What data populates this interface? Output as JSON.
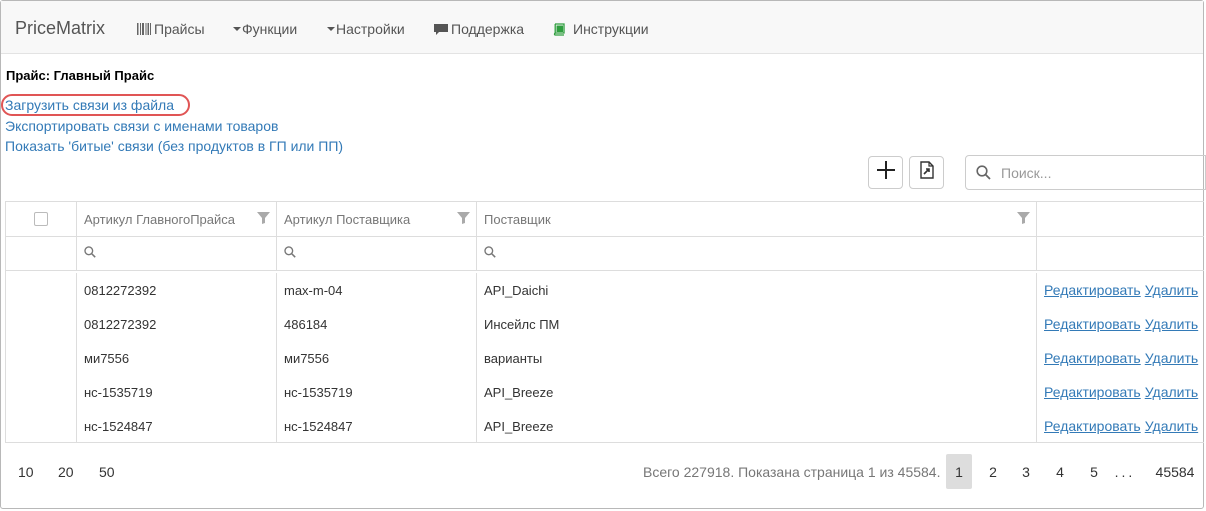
{
  "navbar": {
    "brand": "PriceMatrix",
    "items": [
      {
        "label": "Прайсы",
        "icon": "barcode-icon"
      },
      {
        "label": "Функции",
        "icon": "caret-down-icon"
      },
      {
        "label": "Настройки",
        "icon": "caret-down-icon"
      },
      {
        "label": "Поддержка",
        "icon": "comment-icon"
      },
      {
        "label": "Инструкции",
        "icon": "book-icon"
      }
    ]
  },
  "page": {
    "title": "Прайс: Главный Прайс",
    "links": {
      "upload": "Загрузить связи из файла",
      "export": "Экспортировать связи с именами товаров",
      "broken": "Показать 'битые' связи (без продуктов в ГП или ПП)"
    }
  },
  "toolbar": {
    "add_icon": "plus-icon",
    "export_icon": "export-file-icon",
    "search_placeholder": "Поиск..."
  },
  "table": {
    "columns": [
      "Артикул ГлавногоПрайса",
      "Артикул Поставщика",
      "Поставщик"
    ],
    "rows": [
      {
        "main_sku": "0812272392",
        "supplier_sku": "max-m-04",
        "supplier": "API_Daichi"
      },
      {
        "main_sku": "0812272392",
        "supplier_sku": "486184",
        "supplier": "Инсейлс ПМ"
      },
      {
        "main_sku": "ми7556",
        "supplier_sku": "ми7556",
        "supplier": "варианты"
      },
      {
        "main_sku": "нс-1535719",
        "supplier_sku": "нс-1535719",
        "supplier": "API_Breeze"
      },
      {
        "main_sku": "нс-1524847",
        "supplier_sku": "нс-1524847",
        "supplier": "API_Breeze"
      }
    ],
    "actions": {
      "edit": "Редактировать",
      "delete": "Удалить"
    }
  },
  "pager": {
    "sizes": [
      "10",
      "20",
      "50"
    ],
    "summary": "Всего 227918. Показана страница 1 из 45584.",
    "pages": [
      "1",
      "2",
      "3",
      "4",
      "5"
    ],
    "ellipsis": "...",
    "last": "45584",
    "current": "1"
  },
  "colors": {
    "link": "#337ab7",
    "highlight_circle": "#e05555",
    "active_page": "#dddddd"
  }
}
